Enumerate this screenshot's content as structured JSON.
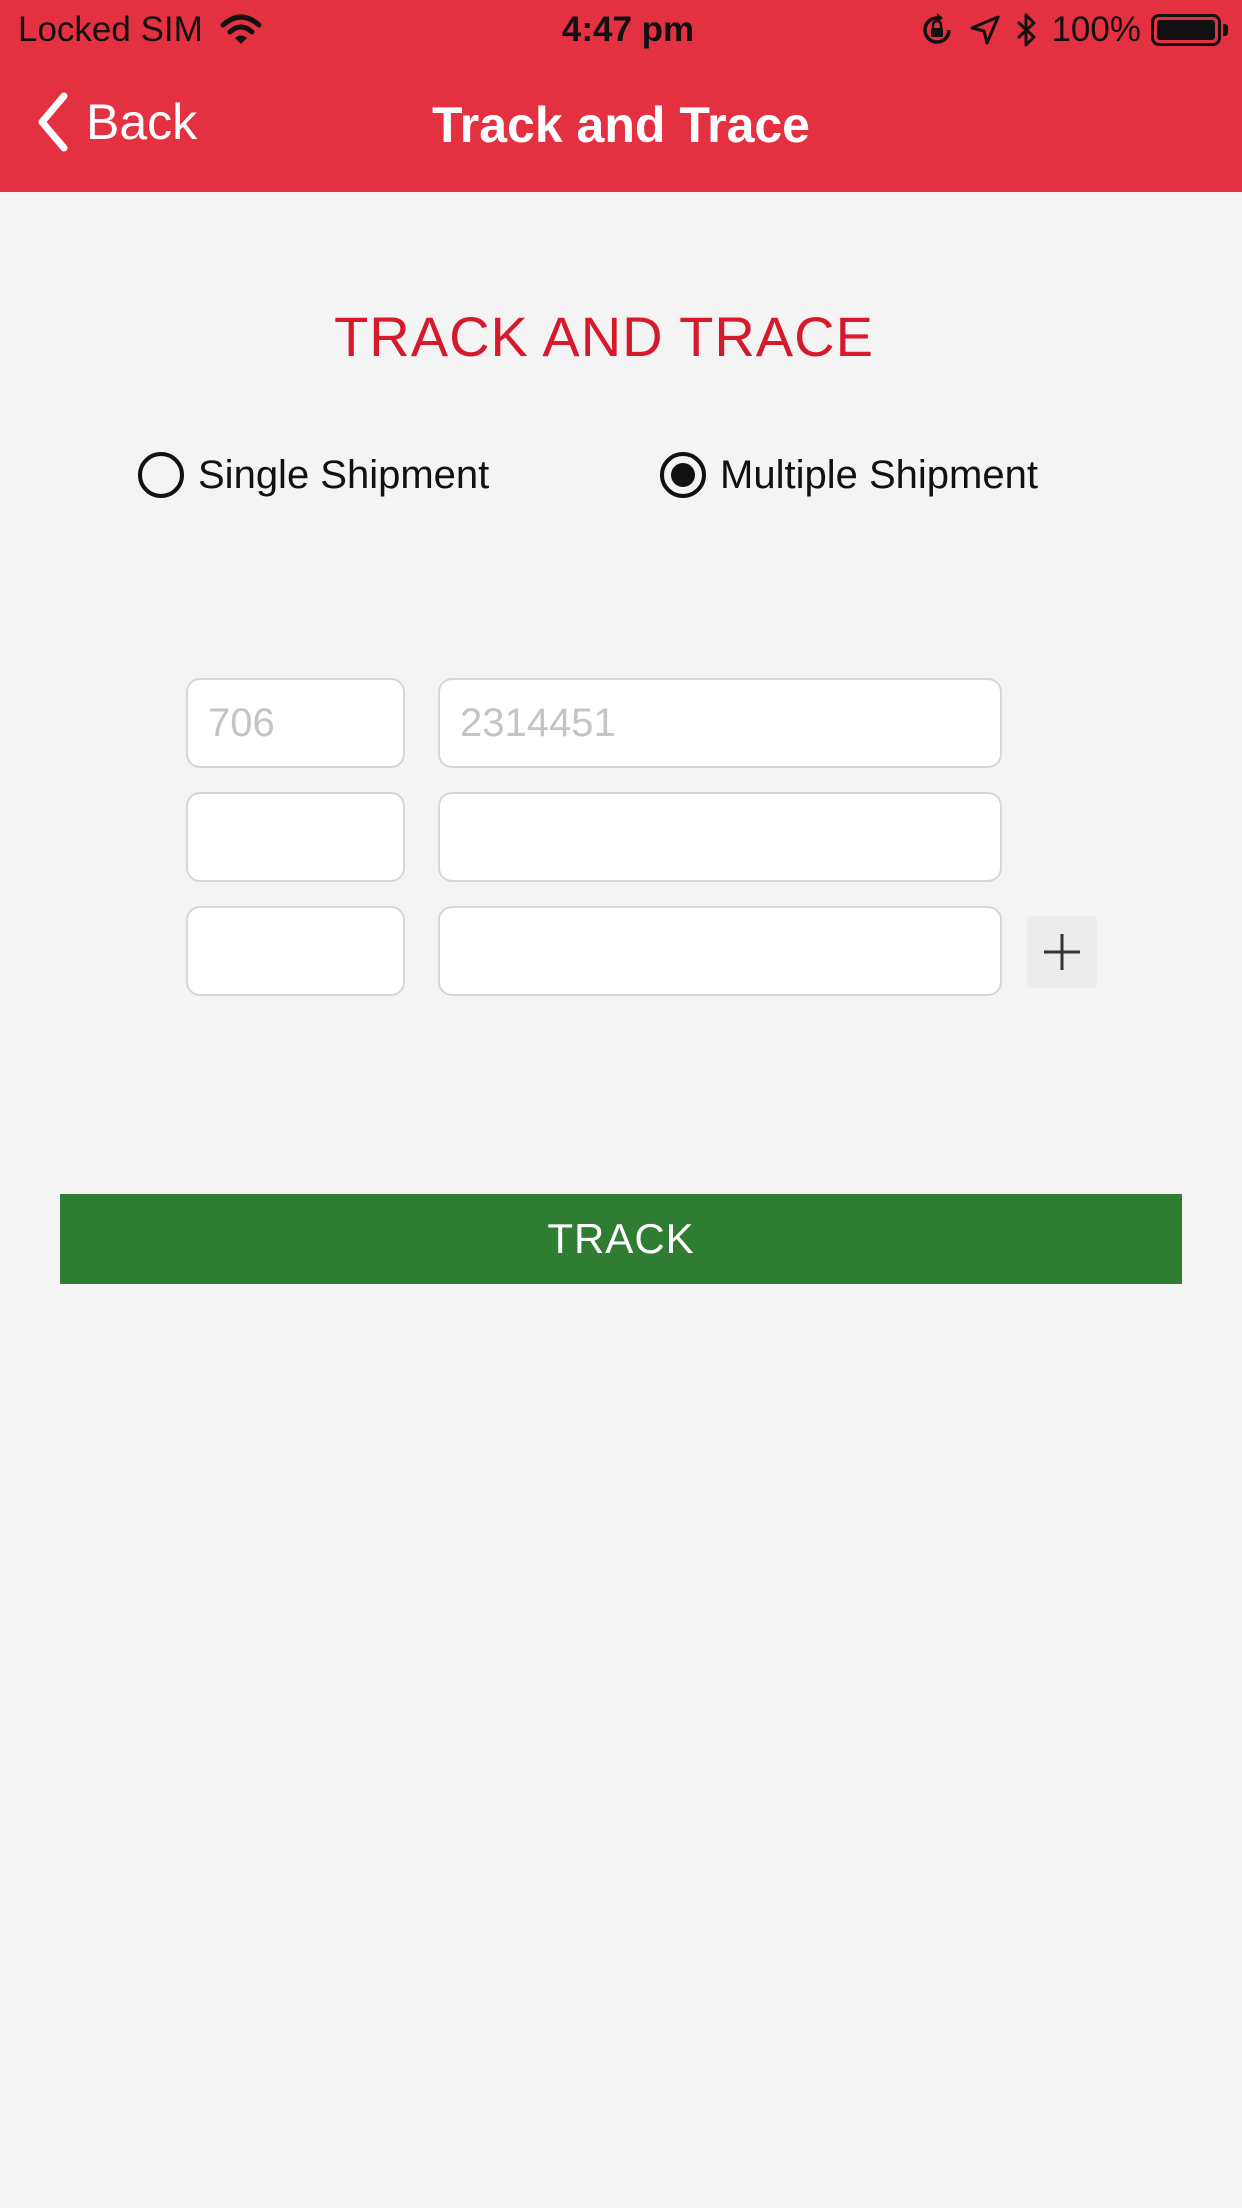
{
  "status_bar": {
    "carrier": "Locked SIM",
    "time": "4:47 pm",
    "battery_percent": "100%",
    "battery_level": 1.0,
    "icons": [
      "wifi-icon",
      "orientation-lock-icon",
      "location-arrow-icon",
      "bluetooth-icon",
      "battery-icon"
    ]
  },
  "header": {
    "back_label": "Back",
    "title": "Track and Trace",
    "color": "#e43141"
  },
  "main": {
    "title": "TRACK AND TRACE",
    "title_color": "#d71a2b",
    "shipment_type": {
      "options": [
        "Single Shipment",
        "Multiple Shipment"
      ],
      "selected": "Multiple Shipment"
    },
    "awb_rows": [
      {
        "prefix_value": "",
        "prefix_placeholder": "706",
        "number_value": "",
        "number_placeholder": "2314451"
      },
      {
        "prefix_value": "",
        "prefix_placeholder": "",
        "number_value": "",
        "number_placeholder": ""
      },
      {
        "prefix_value": "",
        "prefix_placeholder": "",
        "number_value": "",
        "number_placeholder": ""
      }
    ],
    "add_row_icon": "plus-icon",
    "track_label": "TRACK",
    "track_color": "#2f7d33"
  }
}
